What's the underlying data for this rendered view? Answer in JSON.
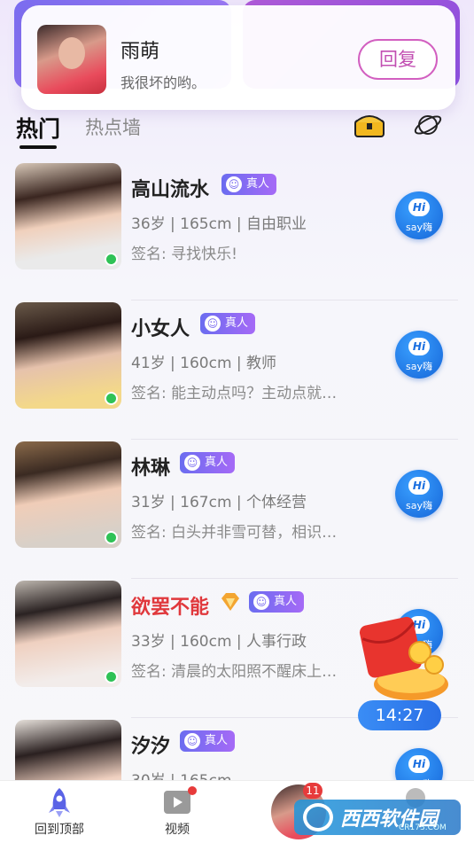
{
  "notification": {
    "name": "雨萌",
    "message": "我很坏的哟。",
    "reply_label": "回复"
  },
  "tabs": {
    "hot": "热门",
    "wall": "热点墙"
  },
  "verified_label": "真人",
  "hi_label": "say嗨",
  "hi_bubble": "Hi",
  "users": [
    {
      "name": "高山流水",
      "info": "36岁 | 165cm | 自由职业",
      "signature": "签名: 寻找快乐!",
      "online": true,
      "vip": false
    },
    {
      "name": "小女人",
      "info": "41岁 | 160cm | 教师",
      "signature": "签名: 能主动点吗？主动点就…",
      "online": true,
      "vip": false
    },
    {
      "name": "林琳",
      "info": "31岁 | 167cm | 个体经营",
      "signature": "签名: 白头并非雪可替，相识…",
      "online": true,
      "vip": false
    },
    {
      "name": "欲罢不能",
      "info": "33岁 | 160cm | 人事行政",
      "signature": "签名: 清晨的太阳照不醒床上…",
      "online": true,
      "vip": true
    },
    {
      "name": "汐汐",
      "info": "30岁 | 165cm",
      "signature": "",
      "online": false,
      "vip": false
    }
  ],
  "timer": "14:27",
  "bottom_nav": {
    "top_label": "回到顶部",
    "video_label": "视频",
    "message_count": "11"
  },
  "watermark": {
    "text": "西西软件园",
    "sub": "CR173.COM"
  }
}
